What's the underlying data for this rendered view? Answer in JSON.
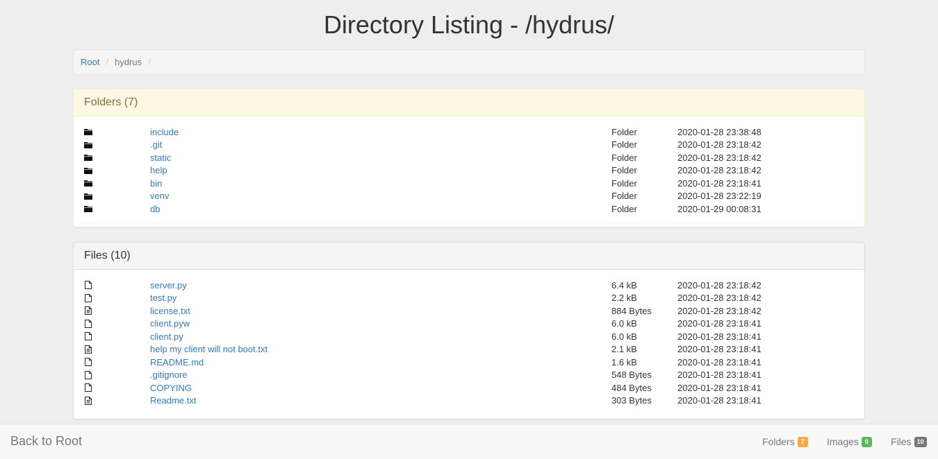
{
  "page": {
    "title": "Directory Listing - /hydrus/"
  },
  "breadcrumb": {
    "root": "Root",
    "current": "hydrus",
    "separator": "/"
  },
  "folders": {
    "heading": "Folders (7)",
    "items": [
      {
        "name": "include",
        "type": "Folder",
        "modified": "2020-01-28 23:38:48",
        "icon": "folder-icon"
      },
      {
        "name": ".git",
        "type": "Folder",
        "modified": "2020-01-28 23:18:42",
        "icon": "folder-icon"
      },
      {
        "name": "static",
        "type": "Folder",
        "modified": "2020-01-28 23:18:42",
        "icon": "folder-icon"
      },
      {
        "name": "help",
        "type": "Folder",
        "modified": "2020-01-28 23:18:42",
        "icon": "folder-icon"
      },
      {
        "name": "bin",
        "type": "Folder",
        "modified": "2020-01-28 23:18:41",
        "icon": "folder-icon"
      },
      {
        "name": "venv",
        "type": "Folder",
        "modified": "2020-01-28 23:22:19",
        "icon": "folder-icon"
      },
      {
        "name": "db",
        "type": "Folder",
        "modified": "2020-01-29 00:08:31",
        "icon": "folder-icon"
      }
    ]
  },
  "files": {
    "heading": "Files (10)",
    "items": [
      {
        "name": "server.py",
        "size": "6.4 kB",
        "modified": "2020-01-28 23:18:42",
        "icon": "file-icon"
      },
      {
        "name": "test.py",
        "size": "2.2 kB",
        "modified": "2020-01-28 23:18:42",
        "icon": "file-icon"
      },
      {
        "name": "license.txt",
        "size": "884 Bytes",
        "modified": "2020-01-28 23:18:42",
        "icon": "text-file-icon"
      },
      {
        "name": "client.pyw",
        "size": "6.0 kB",
        "modified": "2020-01-28 23:18:41",
        "icon": "file-icon"
      },
      {
        "name": "client.py",
        "size": "6.0 kB",
        "modified": "2020-01-28 23:18:41",
        "icon": "file-icon"
      },
      {
        "name": "help my client will not boot.txt",
        "size": "2.1 kB",
        "modified": "2020-01-28 23:18:41",
        "icon": "text-file-icon"
      },
      {
        "name": "README.md",
        "size": "1.6 kB",
        "modified": "2020-01-28 23:18:41",
        "icon": "file-icon"
      },
      {
        "name": ".gitignore",
        "size": "548 Bytes",
        "modified": "2020-01-28 23:18:41",
        "icon": "file-icon"
      },
      {
        "name": "COPYING",
        "size": "484 Bytes",
        "modified": "2020-01-28 23:18:41",
        "icon": "file-icon"
      },
      {
        "name": "Readme.txt",
        "size": "303 Bytes",
        "modified": "2020-01-28 23:18:41",
        "icon": "text-file-icon"
      }
    ]
  },
  "footer": {
    "back_label": "Back to Root",
    "stats": [
      {
        "label": "Folders",
        "count": "7",
        "color": "#f0ad4e"
      },
      {
        "label": "Images",
        "count": "0",
        "color": "#5cb85c"
      },
      {
        "label": "Files",
        "count": "10",
        "color": "#777777"
      }
    ]
  }
}
